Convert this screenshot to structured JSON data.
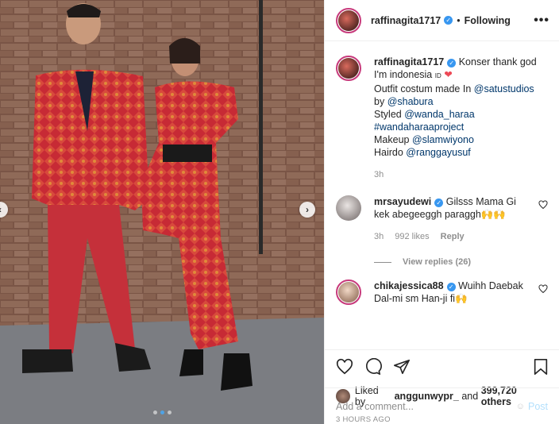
{
  "post": {
    "username": "raffinagita1717",
    "follow_status": "Following",
    "separator": "•",
    "more_label": "•••"
  },
  "caption": {
    "username": "raffinagita1717",
    "line1": "Konser thank god",
    "line2_text": "I'm indonesia",
    "line2_tag": "ID",
    "line3_prefix": "Outfit costum made In ",
    "line3_link": "@satustudios",
    "line4_prefix": "by ",
    "line4_link": "@shabura",
    "line5_prefix": "Styled ",
    "line5_link": "@wanda_haraa",
    "line6_link": "#wandaharaaproject",
    "line7_prefix": "Makeup ",
    "line7_link": "@slamwiyono",
    "line8_prefix": "Hairdo ",
    "line8_link": "@ranggayusuf",
    "time": "3h"
  },
  "comments": [
    {
      "username": "mrsayudewi",
      "text": "Gilsss Mama Gi kek abegeeggh paraggh🙌🙌",
      "time": "3h",
      "likes": "992 likes",
      "reply_label": "Reply",
      "view_replies": "View replies (26)"
    },
    {
      "username": "chikajessica88",
      "text": "Wuihh Daebak Dal-mi sm Han-ji fi🙌"
    }
  ],
  "likes": {
    "prefix": "Liked by ",
    "user": "anggunwypr_",
    "middle": " and ",
    "count": "399,720 others"
  },
  "timestamp": "3 HOURS AGO",
  "add_comment": {
    "placeholder": "Add a comment...",
    "post_label": "Post"
  },
  "carousel": {
    "total": 3,
    "active": 1
  },
  "colors": {
    "verified": "#3897f0",
    "link": "#00376b",
    "muted": "#8e8e8e",
    "post_disabled": "#b2dffc",
    "story_ring": "#c7397b",
    "heart": "#ed4956"
  }
}
